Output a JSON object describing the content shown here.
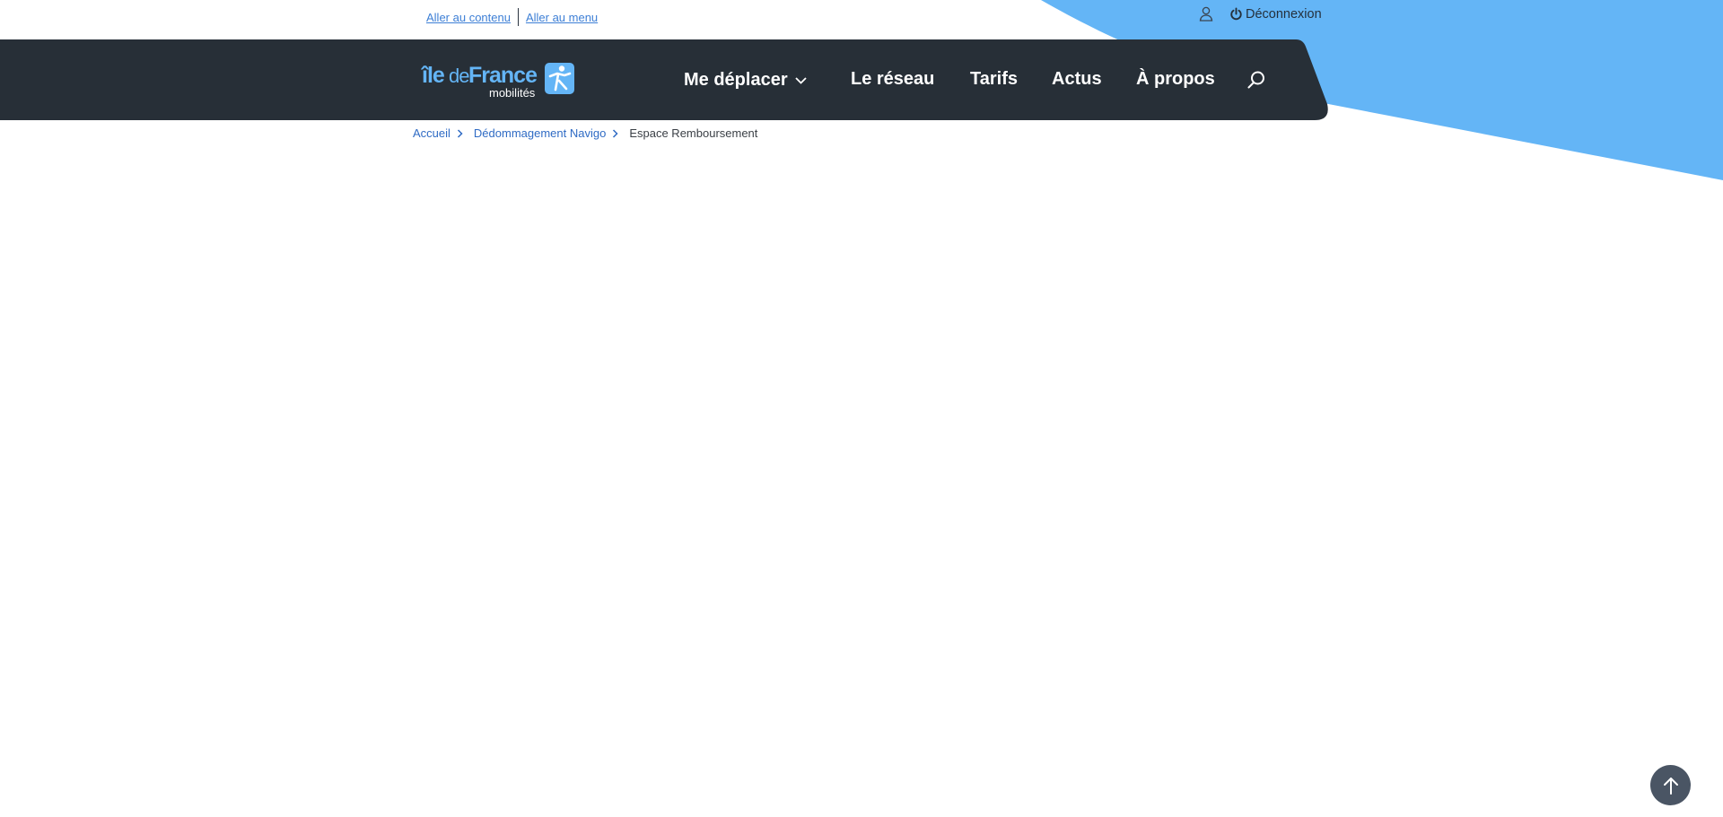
{
  "skip_links": {
    "content": "Aller au contenu",
    "menu": "Aller au menu"
  },
  "account": {
    "user_icon": "user-icon",
    "logout_label": "Déconnexion",
    "logout_icon": "power-icon"
  },
  "logo": {
    "part1": "île",
    "part2": "de",
    "part3": "France",
    "subtitle": "mobilités",
    "mark_icon": "traveler-icon"
  },
  "nav": {
    "items": [
      {
        "label": "Me déplacer",
        "has_dropdown": true
      },
      {
        "label": "Le réseau"
      },
      {
        "label": "Tarifs"
      },
      {
        "label": "Actus"
      },
      {
        "label": "À propos"
      }
    ],
    "search_icon": "search-icon"
  },
  "breadcrumb": [
    {
      "label": "Accueil",
      "link": true
    },
    {
      "label": "Dédommagement Navigo",
      "link": true
    },
    {
      "label": "Espace Remboursement",
      "link": false
    }
  ],
  "scroll_top_icon": "arrow-up-icon",
  "colors": {
    "navbar": "#272f37",
    "accent_blue": "#64b5f6",
    "link_blue": "#2f6bc4",
    "page_bg": "#ffffff"
  }
}
